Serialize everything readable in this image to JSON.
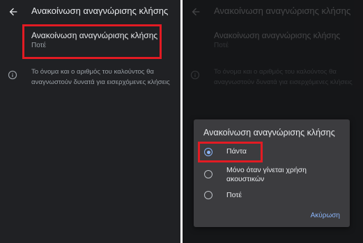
{
  "screen": {
    "title": "Ανακοίνωση αναγνώρισης κλήσης",
    "preference": {
      "label": "Ανακοίνωση αναγνώρισης κλήσης",
      "value": "Ποτέ"
    },
    "info_text": "Το όνομα και ο αριθμός του καλούντος θα αναγνωστούν δυνατά για εισερχόμενες κλήσεις"
  },
  "dialog": {
    "title": "Ανακοίνωση αναγνώρισης κλήσης",
    "options": [
      {
        "label": "Πάντα",
        "checked": true
      },
      {
        "label": "Μόνο όταν γίνεται χρήση ακουστικών",
        "checked": false
      },
      {
        "label": "Ποτέ",
        "checked": false
      }
    ],
    "cancel_label": "Ακύρωση"
  },
  "icons": {
    "back": "arrow-back-icon",
    "info": "info-icon"
  },
  "colors": {
    "background": "#202124",
    "dialog_background": "#3c3c3f",
    "accent": "#8ab4f8",
    "highlight": "#e31b23"
  }
}
